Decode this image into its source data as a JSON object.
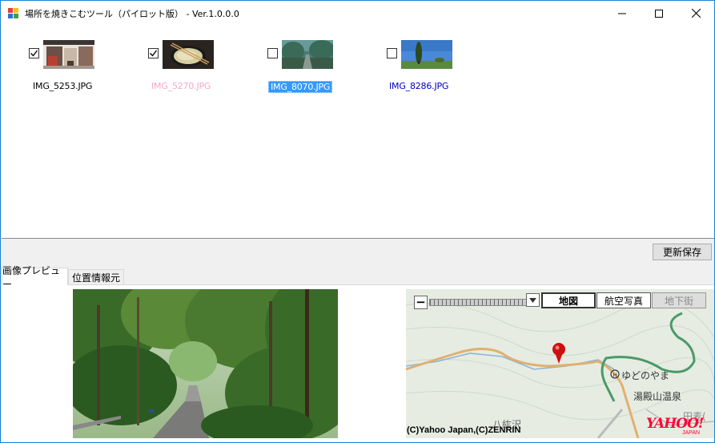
{
  "window": {
    "title": "場所を焼きこむツール（パイロット版） - Ver.1.0.0.0"
  },
  "photos": [
    {
      "filename": "IMG_5253.JPG",
      "checked": true,
      "style": "normal"
    },
    {
      "filename": "IMG_5270.JPG",
      "checked": true,
      "style": "pink"
    },
    {
      "filename": "IMG_8070.JPG",
      "checked": false,
      "style": "selected"
    },
    {
      "filename": "IMG_8286.JPG",
      "checked": false,
      "style": "blue"
    }
  ],
  "toolbar": {
    "update_save_label": "更新保存"
  },
  "tabs": [
    {
      "label": "画像プレビュー",
      "active": true
    },
    {
      "label": "位置情報元",
      "active": false
    }
  ],
  "map": {
    "buttons": {
      "map": "地図",
      "aerial": "航空写真",
      "underground": "地下街"
    },
    "zoom_out": "−",
    "labels": {
      "yudonoyama": "ゆどのやま",
      "yudonosan_onsen": "湯殿山温泉",
      "hachimai": "八紘沢",
      "tashiro": "田麦("
    },
    "copyright": "(C)Yahoo Japan,(C)ZENRIN",
    "logo": "YAHOO!",
    "logo_sub": "JAPAN"
  },
  "colors": {
    "selection": "#3399ff",
    "window_border": "#1883d7",
    "pink_text": "#f5a8c8",
    "blue_text": "#0000c0"
  }
}
